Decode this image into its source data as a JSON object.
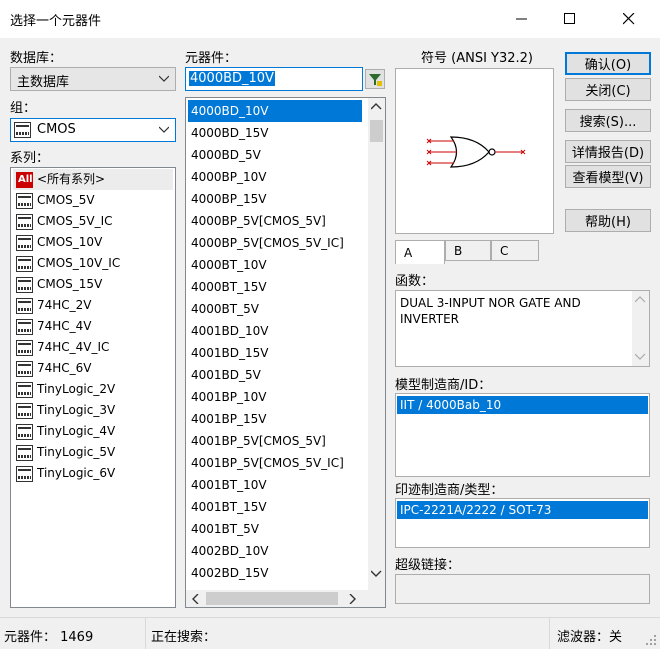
{
  "window": {
    "title": "选择一个元器件"
  },
  "database": {
    "label": "数据库：",
    "selected": "主数据库"
  },
  "group": {
    "label": "组：",
    "selected": "CMOS"
  },
  "family": {
    "label": "系列：",
    "items": [
      {
        "label": "<所有系列>",
        "icon": "all-icon"
      },
      {
        "label": "CMOS_5V",
        "icon": "chip-icon"
      },
      {
        "label": "CMOS_5V_IC",
        "icon": "chip-icon"
      },
      {
        "label": "CMOS_10V",
        "icon": "chip-icon"
      },
      {
        "label": "CMOS_10V_IC",
        "icon": "chip-icon"
      },
      {
        "label": "CMOS_15V",
        "icon": "chip-icon"
      },
      {
        "label": "74HC_2V",
        "icon": "chip-icon"
      },
      {
        "label": "74HC_4V",
        "icon": "chip-icon"
      },
      {
        "label": "74HC_4V_IC",
        "icon": "chip-icon"
      },
      {
        "label": "74HC_6V",
        "icon": "chip-icon"
      },
      {
        "label": "TinyLogic_2V",
        "icon": "chip-icon"
      },
      {
        "label": "TinyLogic_3V",
        "icon": "chip-icon"
      },
      {
        "label": "TinyLogic_4V",
        "icon": "chip-icon"
      },
      {
        "label": "TinyLogic_5V",
        "icon": "chip-icon"
      },
      {
        "label": "TinyLogic_6V",
        "icon": "chip-icon"
      }
    ]
  },
  "component": {
    "label": "元器件：",
    "search_value": "4000BD_10V",
    "items": [
      "4000BD_10V",
      "4000BD_15V",
      "4000BD_5V",
      "4000BP_10V",
      "4000BP_15V",
      "4000BP_5V[CMOS_5V]",
      "4000BP_5V[CMOS_5V_IC]",
      "4000BT_10V",
      "4000BT_15V",
      "4000BT_5V",
      "4001BD_10V",
      "4001BD_15V",
      "4001BD_5V",
      "4001BP_10V",
      "4001BP_15V",
      "4001BP_5V[CMOS_5V]",
      "4001BP_5V[CMOS_5V_IC]",
      "4001BT_10V",
      "4001BT_15V",
      "4001BT_5V",
      "4002BD_10V",
      "4002BD_15V"
    ]
  },
  "symbol": {
    "label": "符号 (ANSI Y32.2)",
    "tabs": [
      "A",
      "B",
      "C"
    ]
  },
  "function": {
    "label": "函数：",
    "text": "DUAL 3-INPUT NOR GATE AND INVERTER"
  },
  "model": {
    "label": "模型制造商/ID：",
    "selected": "IIT / 4000Bab_10"
  },
  "footprint": {
    "label": "印迹制造商/类型：",
    "selected": "IPC-2221A/2222 / SOT-73"
  },
  "hyperlink": {
    "label": "超级链接："
  },
  "buttons": {
    "ok": "确认(O)",
    "close": "关闭(C)",
    "search": "搜索(S)...",
    "detail": "详情报告(D)",
    "model": "查看模型(V)",
    "help": "帮助(H)"
  },
  "status": {
    "count": "元器件：  1469",
    "searching": "正在搜索：",
    "filter": "滤波器：关"
  }
}
